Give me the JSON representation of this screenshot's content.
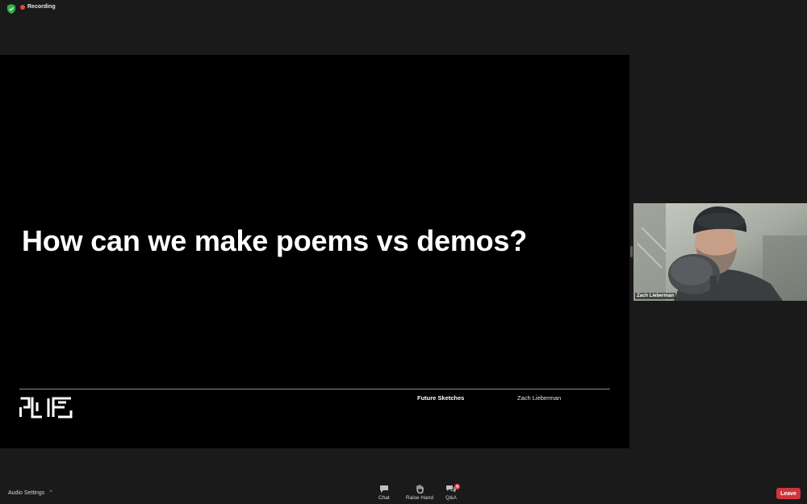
{
  "status_bar": {
    "shield_icon": "green-shield-check",
    "recording_label": "Recording",
    "recording_color": "#e5483f"
  },
  "slide": {
    "title": "How can we make poems vs demos?",
    "footer": {
      "label": "Future Sketches",
      "author": "Zach Lieberman"
    }
  },
  "participant": {
    "name": "Zach Lieberman"
  },
  "toolbar": {
    "audio_settings_label": "Audio Settings",
    "buttons": [
      {
        "label": "Chat",
        "icon": "chat-bubble"
      },
      {
        "label": "Raise Hand",
        "icon": "hand"
      },
      {
        "label": "Q&A",
        "icon": "qa-bubbles",
        "badge": "4"
      }
    ],
    "leave_label": "Leave",
    "leave_color": "#d0343a"
  }
}
